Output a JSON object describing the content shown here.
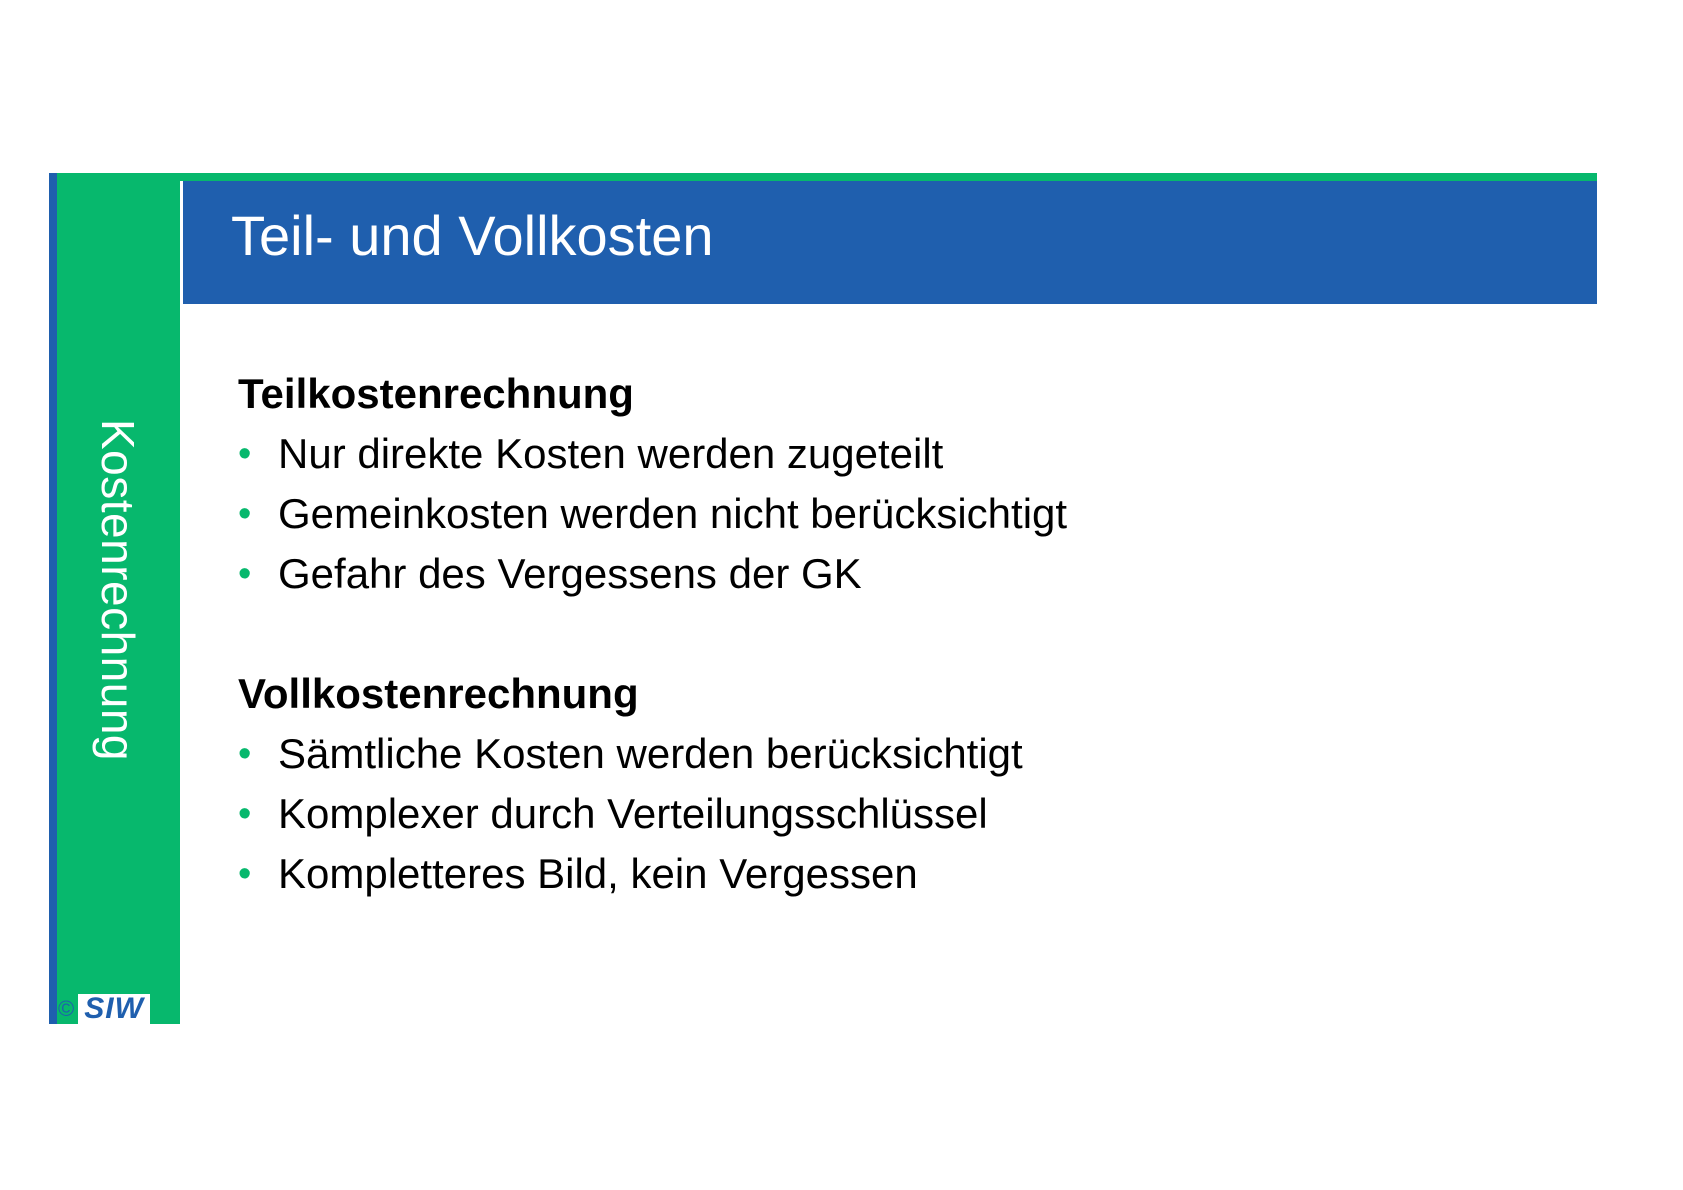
{
  "sidebar": {
    "label": "Kostenrechnung"
  },
  "header": {
    "title": "Teil- und Vollkosten"
  },
  "sections": [
    {
      "title": "Teilkostenrechnung",
      "bullets": [
        "Nur direkte Kosten werden zugeteilt",
        "Gemeinkosten werden nicht berücksichtigt",
        "Gefahr des Vergessens der GK"
      ]
    },
    {
      "title": "Vollkostenrechnung",
      "bullets": [
        "Sämtliche Kosten werden berücksichtigt",
        "Komplexer durch Verteilungsschlüssel",
        "Kompletteres Bild, kein Vergessen"
      ]
    }
  ],
  "footer": {
    "copyright": "©",
    "logo_text": "SIW"
  },
  "colors": {
    "green": "#07b86d",
    "blue": "#1f5fae",
    "bullet": "#07b86d"
  }
}
